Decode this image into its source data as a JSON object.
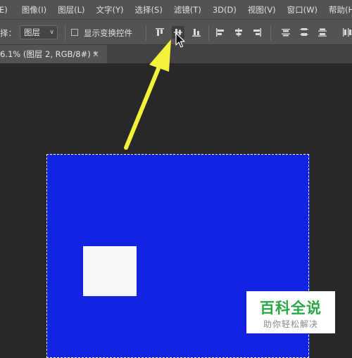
{
  "menu": {
    "items": [
      "E)",
      "图像(I)",
      "图层(L)",
      "文字(Y)",
      "选择(S)",
      "滤镜(T)",
      "3D(D)",
      "视图(V)",
      "窗口(W)",
      "帮助(H)"
    ]
  },
  "options": {
    "select_label": "择：",
    "select_value": "图层",
    "show_transform_label": "显示变换控件",
    "align_icons": [
      "align-top-edges-icon",
      "align-vertical-centers-icon",
      "align-bottom-edges-icon",
      "align-left-edges-icon",
      "align-horizontal-centers-icon",
      "align-right-edges-icon",
      "distribute-top-icon",
      "distribute-vertical-centers-icon",
      "distribute-bottom-icon",
      "distribute-left-icon"
    ]
  },
  "document_tab": {
    "title": "6.1% (图层 2, RGB/8#) *",
    "close": "×"
  },
  "colors": {
    "canvas": "#1024e2",
    "arrow": "#f2f23a",
    "workspace": "#282828"
  },
  "watermark": {
    "title": "百科全说",
    "subtitle": "助你轻松解决"
  }
}
